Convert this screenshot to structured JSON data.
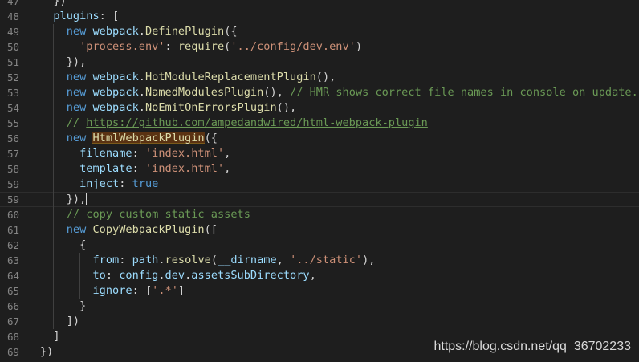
{
  "editor": {
    "current_line": 59,
    "lines": [
      {
        "n": "47",
        "indent": 0,
        "tokens": [
          {
            "t": "  })",
            "c": "punc"
          }
        ]
      },
      {
        "n": "48",
        "indent": 0,
        "tokens": [
          {
            "t": "  plugins",
            "c": "var"
          },
          {
            "t": ": [",
            "c": "punc"
          }
        ]
      },
      {
        "n": "49",
        "indent": 1,
        "tokens": [
          {
            "t": "    new ",
            "c": "kw"
          },
          {
            "t": "webpack",
            "c": "var"
          },
          {
            "t": ".",
            "c": "punc"
          },
          {
            "t": "DefinePlugin",
            "c": "fn"
          },
          {
            "t": "({",
            "c": "punc"
          }
        ]
      },
      {
        "n": "50",
        "indent": 2,
        "tokens": [
          {
            "t": "      'process.env'",
            "c": "str"
          },
          {
            "t": ": ",
            "c": "punc"
          },
          {
            "t": "require",
            "c": "fn"
          },
          {
            "t": "(",
            "c": "punc"
          },
          {
            "t": "'../config/dev.env'",
            "c": "str"
          },
          {
            "t": ")",
            "c": "punc"
          }
        ]
      },
      {
        "n": "51",
        "indent": 1,
        "tokens": [
          {
            "t": "    }),",
            "c": "punc"
          }
        ]
      },
      {
        "n": "52",
        "indent": 1,
        "tokens": [
          {
            "t": "    new ",
            "c": "kw"
          },
          {
            "t": "webpack",
            "c": "var"
          },
          {
            "t": ".",
            "c": "punc"
          },
          {
            "t": "HotModuleReplacementPlugin",
            "c": "fn"
          },
          {
            "t": "(),",
            "c": "punc"
          }
        ]
      },
      {
        "n": "53",
        "indent": 1,
        "tokens": [
          {
            "t": "    new ",
            "c": "kw"
          },
          {
            "t": "webpack",
            "c": "var"
          },
          {
            "t": ".",
            "c": "punc"
          },
          {
            "t": "NamedModulesPlugin",
            "c": "fn"
          },
          {
            "t": "(), ",
            "c": "punc"
          },
          {
            "t": "// HMR shows correct file names in console on update.",
            "c": "cmt"
          }
        ]
      },
      {
        "n": "54",
        "indent": 1,
        "tokens": [
          {
            "t": "    new ",
            "c": "kw"
          },
          {
            "t": "webpack",
            "c": "var"
          },
          {
            "t": ".",
            "c": "punc"
          },
          {
            "t": "NoEmitOnErrorsPlugin",
            "c": "fn"
          },
          {
            "t": "(),",
            "c": "punc"
          }
        ]
      },
      {
        "n": "55",
        "indent": 1,
        "tokens": [
          {
            "t": "    // ",
            "c": "cmt"
          },
          {
            "t": "https://github.com/ampedandwired/html-webpack-plugin",
            "c": "url"
          }
        ]
      },
      {
        "n": "56",
        "indent": 1,
        "tokens": [
          {
            "t": "    new ",
            "c": "kw"
          },
          {
            "t": "HtmlWebpackPlugin",
            "c": "hl"
          },
          {
            "t": "({",
            "c": "punc"
          }
        ]
      },
      {
        "n": "57",
        "indent": 2,
        "tokens": [
          {
            "t": "      filename",
            "c": "var"
          },
          {
            "t": ": ",
            "c": "punc"
          },
          {
            "t": "'index.html'",
            "c": "str"
          },
          {
            "t": ",",
            "c": "punc"
          }
        ]
      },
      {
        "n": "58",
        "indent": 2,
        "tokens": [
          {
            "t": "      template",
            "c": "var"
          },
          {
            "t": ": ",
            "c": "punc"
          },
          {
            "t": "'index.html'",
            "c": "str"
          },
          {
            "t": ",",
            "c": "punc"
          }
        ]
      },
      {
        "n": "59",
        "indent": 2,
        "tokens": [
          {
            "t": "      inject",
            "c": "var"
          },
          {
            "t": ": ",
            "c": "punc"
          },
          {
            "t": "true",
            "c": "kw"
          }
        ]
      },
      {
        "n": "59",
        "indent": 1,
        "tokens": [
          {
            "t": "    }),",
            "c": "punc"
          }
        ],
        "cursor": true
      },
      {
        "n": "60",
        "indent": 1,
        "tokens": [
          {
            "t": "    // copy custom static assets",
            "c": "cmt"
          }
        ]
      },
      {
        "n": "61",
        "indent": 1,
        "tokens": [
          {
            "t": "    new ",
            "c": "kw"
          },
          {
            "t": "CopyWebpackPlugin",
            "c": "fn"
          },
          {
            "t": "([",
            "c": "punc"
          }
        ]
      },
      {
        "n": "62",
        "indent": 2,
        "tokens": [
          {
            "t": "      {",
            "c": "punc"
          }
        ]
      },
      {
        "n": "63",
        "indent": 3,
        "tokens": [
          {
            "t": "        from",
            "c": "var"
          },
          {
            "t": ": ",
            "c": "punc"
          },
          {
            "t": "path",
            "c": "var"
          },
          {
            "t": ".",
            "c": "punc"
          },
          {
            "t": "resolve",
            "c": "fn"
          },
          {
            "t": "(",
            "c": "punc"
          },
          {
            "t": "__dirname",
            "c": "var"
          },
          {
            "t": ", ",
            "c": "punc"
          },
          {
            "t": "'../static'",
            "c": "str"
          },
          {
            "t": "),",
            "c": "punc"
          }
        ]
      },
      {
        "n": "64",
        "indent": 3,
        "tokens": [
          {
            "t": "        to",
            "c": "var"
          },
          {
            "t": ": ",
            "c": "punc"
          },
          {
            "t": "config",
            "c": "var"
          },
          {
            "t": ".",
            "c": "punc"
          },
          {
            "t": "dev",
            "c": "var"
          },
          {
            "t": ".",
            "c": "punc"
          },
          {
            "t": "assetsSubDirectory",
            "c": "var"
          },
          {
            "t": ",",
            "c": "punc"
          }
        ]
      },
      {
        "n": "65",
        "indent": 3,
        "tokens": [
          {
            "t": "        ignore",
            "c": "var"
          },
          {
            "t": ": [",
            "c": "punc"
          },
          {
            "t": "'.*'",
            "c": "str"
          },
          {
            "t": "]",
            "c": "punc"
          }
        ]
      },
      {
        "n": "66",
        "indent": 2,
        "tokens": [
          {
            "t": "      }",
            "c": "punc"
          }
        ]
      },
      {
        "n": "67",
        "indent": 1,
        "tokens": [
          {
            "t": "    ])",
            "c": "punc"
          }
        ]
      },
      {
        "n": "68",
        "indent": 0,
        "tokens": [
          {
            "t": "  ]",
            "c": "punc"
          }
        ]
      },
      {
        "n": "69",
        "indent": 0,
        "tokens": [
          {
            "t": "})",
            "c": "punc"
          }
        ]
      }
    ]
  },
  "watermark": "https://blog.csdn.net/qq_36702233"
}
